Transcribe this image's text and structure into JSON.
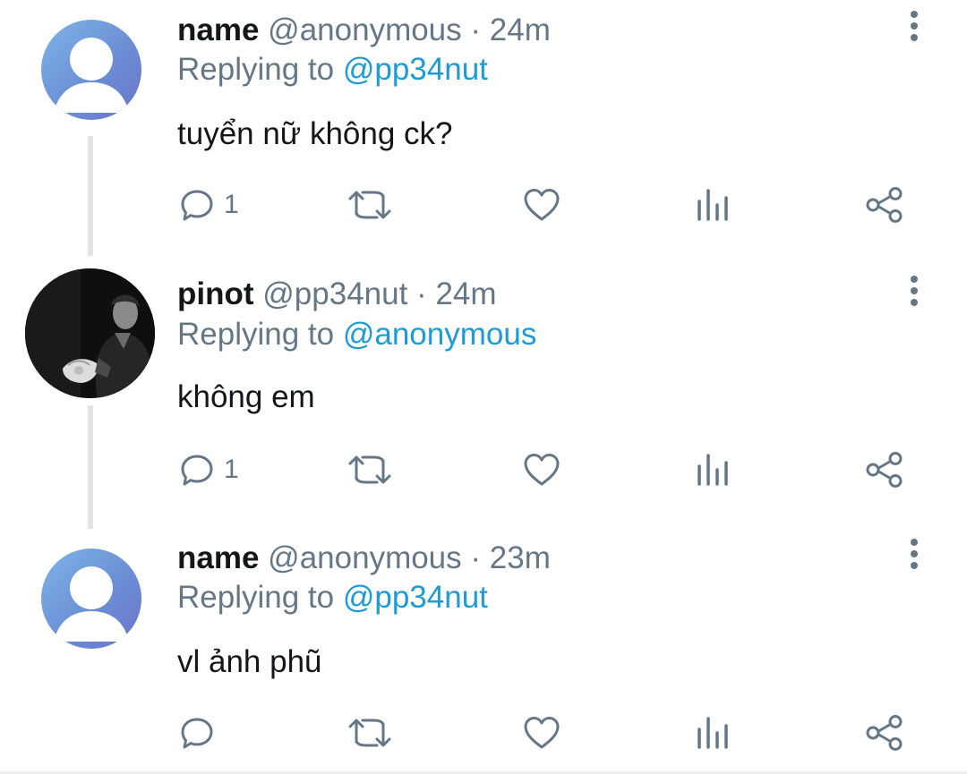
{
  "tweets": [
    {
      "name": "name",
      "handle": "@anonymous",
      "time": "24m",
      "replying_prefix": "Replying to",
      "replying_to": "@pp34nut",
      "text": "tuyển nữ không ck?",
      "reply_count": "1",
      "avatar": "default-avatar"
    },
    {
      "name": "pinot",
      "handle": "@pp34nut",
      "time": "24m",
      "replying_prefix": "Replying to",
      "replying_to": "@anonymous",
      "text": "không em",
      "reply_count": "1",
      "avatar": "photo-avatar"
    },
    {
      "name": "name",
      "handle": "@anonymous",
      "time": "23m",
      "replying_prefix": "Replying to",
      "replying_to": "@pp34nut",
      "text": "vl ảnh phũ",
      "reply_count": "",
      "avatar": "default-avatar"
    }
  ],
  "separator": "·",
  "icons": [
    "reply-icon",
    "retweet-icon",
    "like-icon",
    "analytics-icon",
    "share-icon",
    "more-options-icon"
  ],
  "colors": {
    "mention": "#1d9bd8",
    "secondary": "#657786",
    "primary_text": "#14171a",
    "thread_line": "#e1e4e6"
  }
}
